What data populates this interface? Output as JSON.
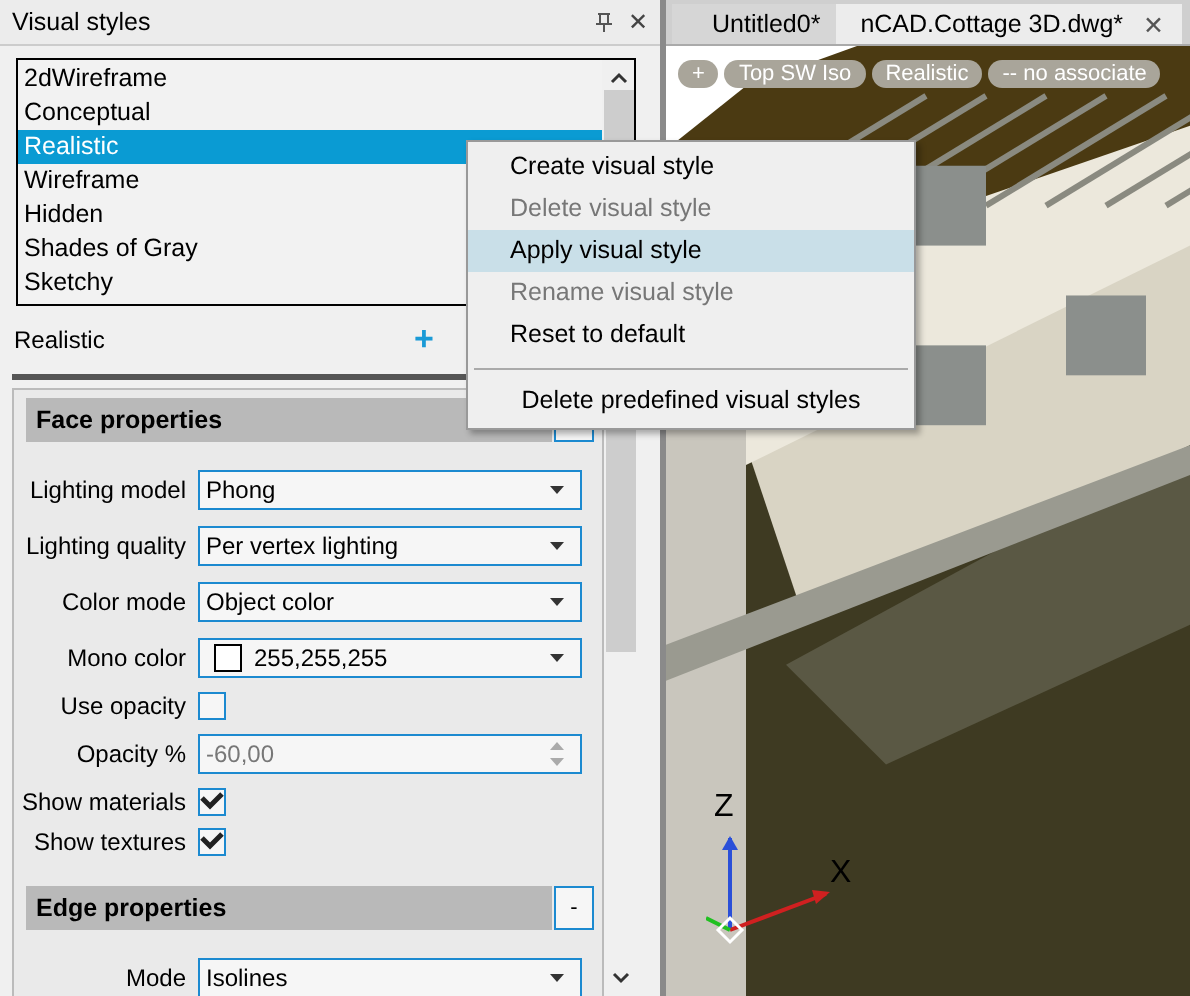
{
  "panel": {
    "title": "Visual styles",
    "close": "✕",
    "styles": [
      {
        "label": "2dWireframe",
        "selected": false
      },
      {
        "label": "Conceptual",
        "selected": false
      },
      {
        "label": "Realistic",
        "selected": true
      },
      {
        "label": "Wireframe",
        "selected": false
      },
      {
        "label": "Hidden",
        "selected": false
      },
      {
        "label": "Shades of Gray",
        "selected": false
      },
      {
        "label": "Sketchy",
        "selected": false
      }
    ],
    "current": "Realistic",
    "add": "+",
    "sections": [
      {
        "title": "Face properties",
        "rows": [
          {
            "kind": "dropdown",
            "label": "Lighting model",
            "value": "Phong"
          },
          {
            "kind": "dropdown",
            "label": "Lighting quality",
            "value": "Per vertex lighting"
          },
          {
            "kind": "dropdown",
            "label": "Color mode",
            "value": "Object color"
          },
          {
            "kind": "color",
            "label": "Mono color",
            "value": "255,255,255",
            "color": "#ffffff"
          },
          {
            "kind": "checkbox",
            "label": "Use opacity",
            "checked": false
          },
          {
            "kind": "spinner",
            "label": "Opacity %",
            "value": "-60,00",
            "disabled": true
          },
          {
            "kind": "checkbox",
            "label": "Show materials",
            "checked": true
          },
          {
            "kind": "checkbox",
            "label": "Show textures",
            "checked": true
          }
        ]
      },
      {
        "title": "Edge properties",
        "toggle": "-",
        "rows": [
          {
            "kind": "dropdown",
            "label": "Mode",
            "value": "Isolines"
          }
        ]
      }
    ]
  },
  "tabs": [
    {
      "label": "Untitled0*",
      "selected": false
    },
    {
      "label": "nCAD.Cottage 3D.dwg*",
      "selected": true,
      "close": "✕"
    }
  ],
  "viewport": {
    "controls": [
      "+",
      "Top SW Iso",
      "Realistic",
      "-- no associate"
    ],
    "axes": {
      "z": "Z",
      "x": "X"
    }
  },
  "context_menu": {
    "items": [
      {
        "label": "Create visual style",
        "disabled": false,
        "selected": false
      },
      {
        "label": "Delete visual style",
        "disabled": true,
        "selected": false
      },
      {
        "label": "Apply visual style",
        "disabled": false,
        "selected": true
      },
      {
        "label": "Rename visual style",
        "disabled": true,
        "selected": false
      },
      {
        "label": "Reset to default",
        "disabled": false,
        "selected": false
      }
    ],
    "footer": "Delete predefined visual styles"
  }
}
